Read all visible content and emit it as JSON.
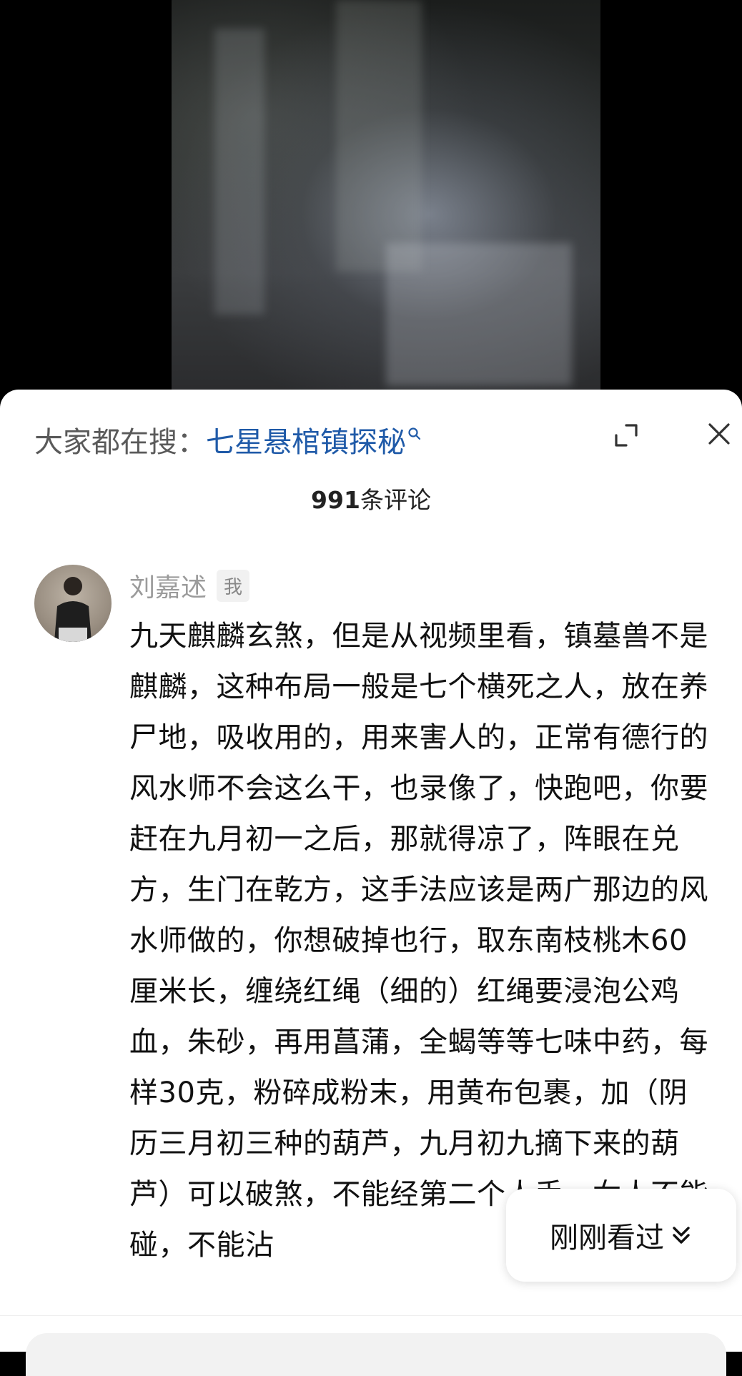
{
  "search": {
    "prefix": "大家都在搜：",
    "term": "七星悬棺镇探秘"
  },
  "comments_header": {
    "count": "991",
    "suffix": "条评论"
  },
  "comment": {
    "author": "刘嘉述",
    "badge": "我",
    "text": "九天麒麟玄煞，但是从视频里看，镇墓兽不是麒麟，这种布局一般是七个横死之人，放在养尸地，吸收用的，用来害人的，正常有德行的风水师不会这么干，也录像了，快跑吧，你要赶在九月初一之后，那就得凉了，阵眼在兑方，生门在乾方，这手法应该是两广那边的风水师做的，你想破掉也行，取东南枝桃木60厘米长，缠绕红绳（细的）红绳要浸泡公鸡血，朱砂，再用菖蒲，全蝎等等七味中药，每样30克，粉碎成粉末，用黄布包裹，加（阴历三月初三种的葫芦，九月初九摘下来的葫芦）可以破煞，不能经第二个人手，女人不能碰，不能沾"
  },
  "recent_button": {
    "label": "刚刚看过"
  },
  "colors": {
    "link": "#1f5aa8",
    "text": "#111111",
    "muted": "#9b9b9b"
  }
}
